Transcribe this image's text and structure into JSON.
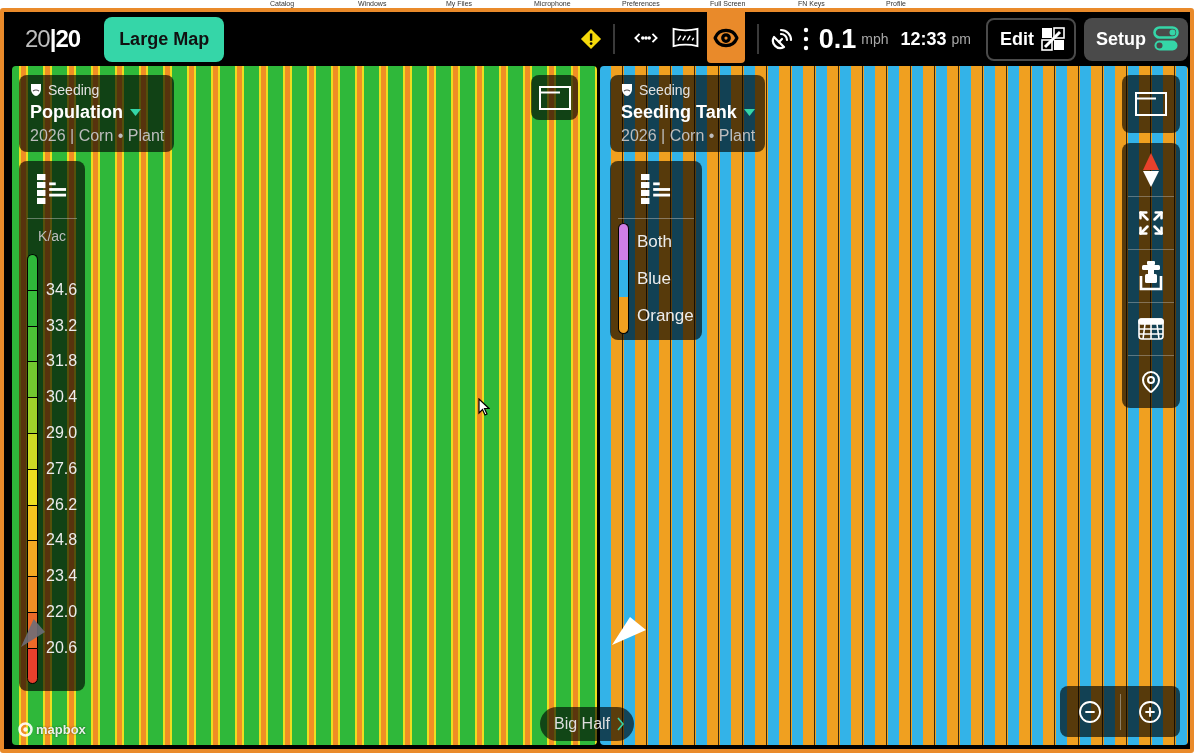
{
  "host_menu": [
    "Catalog",
    "Windows",
    "My Files",
    "Microphone",
    "Preferences",
    "Full Screen",
    "FN Keys",
    "Profile"
  ],
  "top_bar": {
    "logo": "20**|20**",
    "view_button": "Large Map",
    "warning": true,
    "tools": [
      {
        "kind": "swath",
        "selected": false
      },
      {
        "kind": "screen",
        "selected": false
      },
      {
        "kind": "eye",
        "selected": true
      }
    ],
    "speed": {
      "value": "0.1",
      "unit": "mph"
    },
    "clock": {
      "time": "12:33",
      "period": "pm"
    },
    "actions": [
      {
        "kind": "edit",
        "label": "Edit"
      },
      {
        "kind": "setup",
        "label": "Setup"
      }
    ]
  },
  "maps": [
    {
      "kind": "scale",
      "category": "Seeding",
      "layer": "Population",
      "details": "2026 | Corn • Plant",
      "legend": {
        "unit": "K/ac",
        "bins": [
          {
            "color": "#2fb83a"
          },
          {
            "label": "34.6",
            "color": "#36bc3a"
          },
          {
            "label": "33.2",
            "color": "#4cc236"
          },
          {
            "label": "31.8",
            "color": "#72c92f"
          },
          {
            "label": "30.4",
            "color": "#9fd22a"
          },
          {
            "label": "29.0",
            "color": "#cddc24"
          },
          {
            "label": "27.6",
            "color": "#ecde20"
          },
          {
            "label": "26.2",
            "color": "#f4c41f"
          },
          {
            "label": "24.8",
            "color": "#f3a922"
          },
          {
            "label": "23.4",
            "color": "#f08e24"
          },
          {
            "label": "22.0",
            "color": "#ec6a28"
          },
          {
            "label": "20.6",
            "color": "#e7402c"
          }
        ]
      }
    },
    {
      "kind": "classes",
      "category": "Seeding",
      "layer": "Seeding Tank",
      "details": "2026 | Corn • Plant",
      "legend": {
        "items": [
          {
            "label": "Both",
            "color": "#d07ee6"
          },
          {
            "label": "Blue",
            "color": "#33b3e8"
          },
          {
            "label": "Orange",
            "color": "#f0a020"
          }
        ]
      }
    }
  ],
  "split_control": {
    "label": "Big Half"
  },
  "attribution": "mapbox"
}
